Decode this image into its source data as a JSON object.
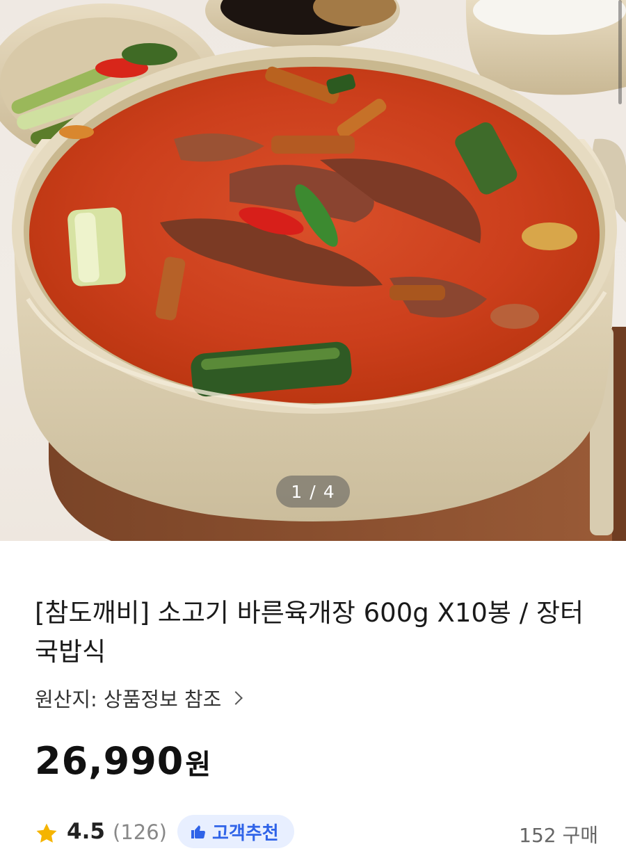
{
  "hero": {
    "counter_current": "1",
    "counter_separator": "/",
    "counter_total": "4"
  },
  "product": {
    "title": "[참도깨비] 소고기 바른육개장 600g X10봉 / 장터국밥식",
    "origin": "원산지: 상품정보 참조",
    "price_amount": "26,990",
    "price_unit": "원",
    "rating": "4.5",
    "review_count": "(126)",
    "badge_label": "고객추천",
    "sold_count": "152 구매"
  },
  "colors": {
    "badge_bg": "#e8efff",
    "badge_text": "#2f63e8",
    "star": "#f5b400"
  },
  "icons": {
    "origin_chevron": "chevron-right-icon",
    "rating_star": "star-icon",
    "badge": "thumbs-up-icon"
  }
}
